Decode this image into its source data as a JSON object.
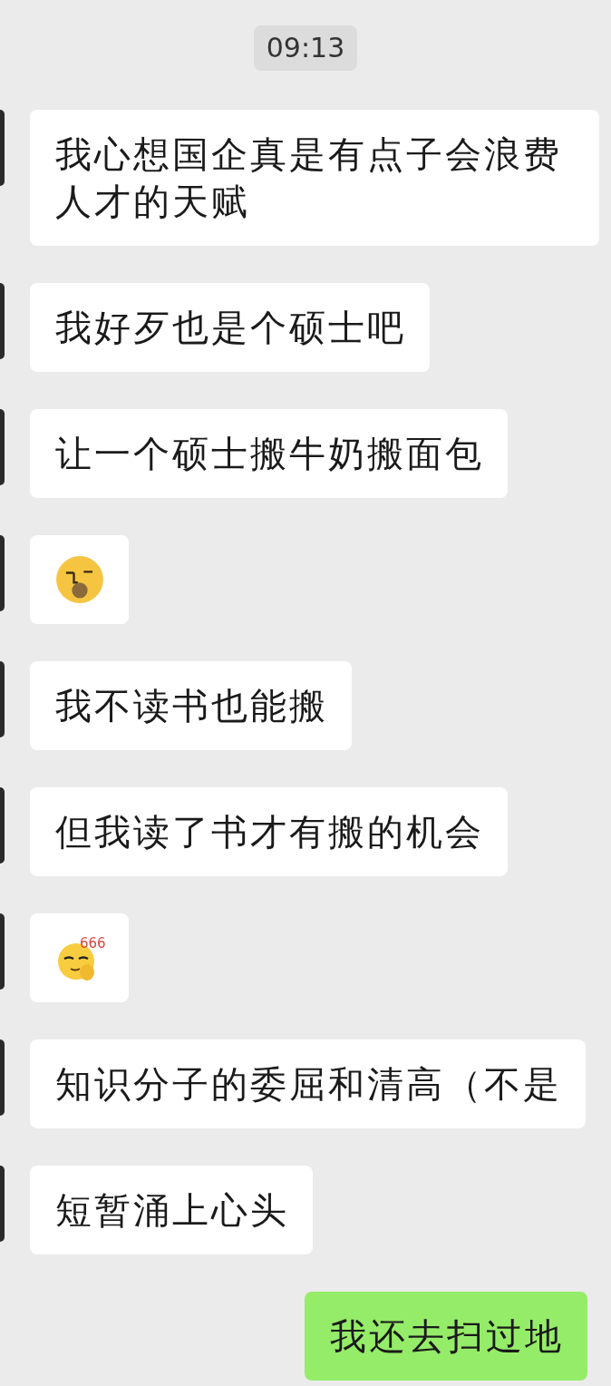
{
  "timestamp": "09:13",
  "messages": [
    {
      "kind": "text",
      "outgoing": false,
      "text": "我心想国企真是有点子会浪费人才的天赋"
    },
    {
      "kind": "text",
      "outgoing": false,
      "text": "我好歹也是个硕士吧"
    },
    {
      "kind": "text",
      "outgoing": false,
      "text": "让一个硕士搬牛奶搬面包"
    },
    {
      "kind": "yawn",
      "outgoing": false
    },
    {
      "kind": "text",
      "outgoing": false,
      "text": "我不读书也能搬"
    },
    {
      "kind": "text",
      "outgoing": false,
      "text": "但我读了书才有搬的机会"
    },
    {
      "kind": "smirk",
      "outgoing": false,
      "caption": "666"
    },
    {
      "kind": "text",
      "outgoing": false,
      "text": "知识分子的委屈和清高（不是"
    },
    {
      "kind": "text",
      "outgoing": false,
      "text": "短暂涌上心头"
    },
    {
      "kind": "text",
      "outgoing": true,
      "text": "我还去扫过地"
    }
  ]
}
